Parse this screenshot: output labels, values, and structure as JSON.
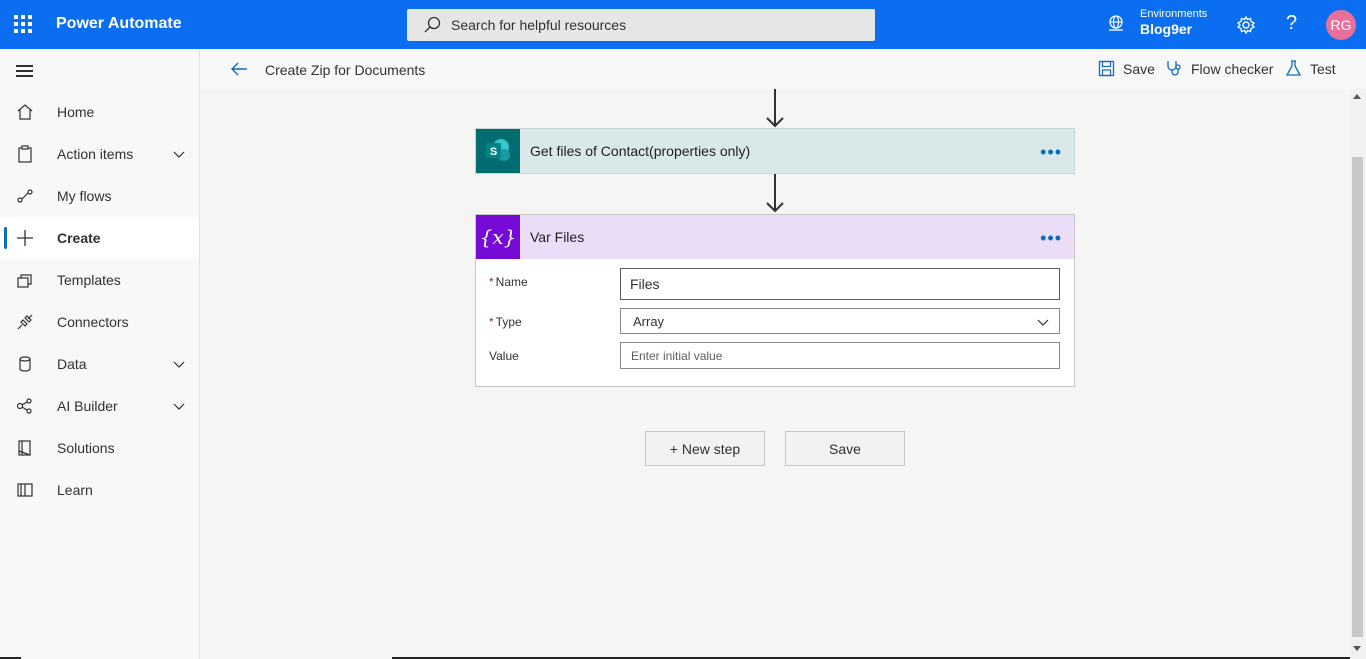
{
  "header": {
    "app_title": "Power Automate",
    "search_placeholder": "Search for helpful resources",
    "environment_label": "Environments",
    "environment_name": "Blog9er",
    "help_glyph": "?",
    "avatar_initials": "RG",
    "brand_color": "#0b6ef0"
  },
  "sidebar": {
    "items": [
      {
        "label": "Home",
        "icon": "home-icon"
      },
      {
        "label": "Action items",
        "icon": "clipboard-icon",
        "expandable": true
      },
      {
        "label": "My flows",
        "icon": "flow-icon"
      },
      {
        "label": "Create",
        "icon": "plus-icon",
        "active": true
      },
      {
        "label": "Templates",
        "icon": "templates-icon"
      },
      {
        "label": "Connectors",
        "icon": "connector-icon"
      },
      {
        "label": "Data",
        "icon": "database-icon",
        "expandable": true
      },
      {
        "label": "AI Builder",
        "icon": "ai-builder-icon",
        "expandable": true
      },
      {
        "label": "Solutions",
        "icon": "solutions-icon"
      },
      {
        "label": "Learn",
        "icon": "book-icon"
      }
    ]
  },
  "commandbar": {
    "flow_name": "Create Zip for Documents",
    "save_label": "Save",
    "checker_label": "Flow checker",
    "test_label": "Test"
  },
  "steps": {
    "step1": {
      "title": "Get files of Contact(properties only)",
      "icon_letter": "S",
      "color": "#036c70"
    },
    "step2": {
      "title": "Var Files",
      "icon_text": "{x}",
      "color": "#770bd6",
      "fields": {
        "name_label": "Name",
        "name_value": "Files",
        "type_label": "Type",
        "type_value": "Array",
        "value_label": "Value",
        "value_placeholder": "Enter initial value",
        "required_mark": "*"
      }
    }
  },
  "actions": {
    "new_step_label": "+ New step",
    "save_label": "Save"
  }
}
